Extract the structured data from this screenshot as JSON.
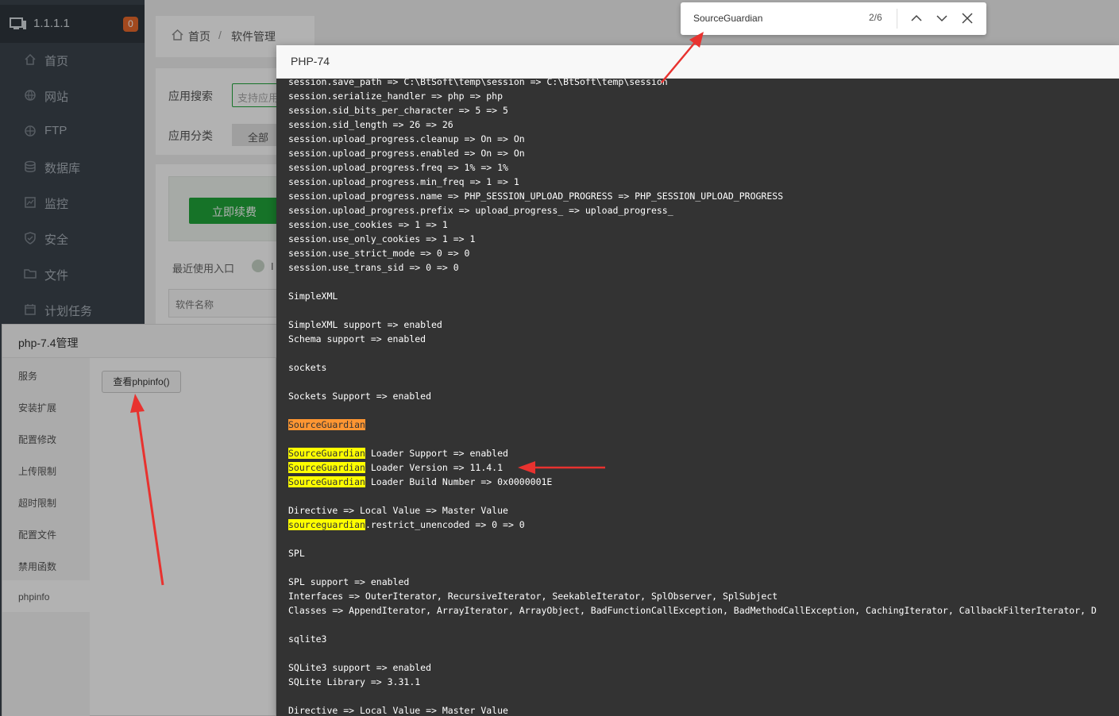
{
  "sidebar": {
    "ip": "1.1.1.1",
    "badge": "0",
    "items": [
      {
        "label": "首页"
      },
      {
        "label": "网站"
      },
      {
        "label": "FTP"
      },
      {
        "label": "数据库"
      },
      {
        "label": "监控"
      },
      {
        "label": "安全"
      },
      {
        "label": "文件"
      },
      {
        "label": "计划任务"
      }
    ]
  },
  "breadcrumb": {
    "home": "首页",
    "separator": "/",
    "current": "软件管理"
  },
  "main": {
    "search_label": "应用搜索",
    "search_placeholder": "支持应用",
    "category_label": "应用分类",
    "category_all": "全部",
    "renew_button": "立即续费",
    "recent_label": "最近使用入口",
    "recent_extra": "I",
    "table_header_name": "软件名称"
  },
  "php_manager": {
    "title": "php-7.4管理",
    "nav": [
      {
        "label": "服务"
      },
      {
        "label": "安装扩展"
      },
      {
        "label": "配置修改"
      },
      {
        "label": "上传限制"
      },
      {
        "label": "超时限制"
      },
      {
        "label": "配置文件"
      },
      {
        "label": "禁用函数"
      },
      {
        "label": "phpinfo"
      }
    ],
    "phpinfo_button": "查看phpinfo()"
  },
  "php_dialog": {
    "title": "PHP-74",
    "lines": [
      "session.save_path => C:\\BtSoft\\temp\\session => C:\\BtSoft\\temp\\session",
      "session.serialize_handler => php => php",
      "session.sid_bits_per_character => 5 => 5",
      "session.sid_length => 26 => 26",
      "session.upload_progress.cleanup => On => On",
      "session.upload_progress.enabled => On => On",
      "session.upload_progress.freq => 1% => 1%",
      "session.upload_progress.min_freq => 1 => 1",
      "session.upload_progress.name => PHP_SESSION_UPLOAD_PROGRESS => PHP_SESSION_UPLOAD_PROGRESS",
      "session.upload_progress.prefix => upload_progress_ => upload_progress_",
      "session.use_cookies => 1 => 1",
      "session.use_only_cookies => 1 => 1",
      "session.use_strict_mode => 0 => 0",
      "session.use_trans_sid => 0 => 0",
      "",
      "SimpleXML",
      "",
      "SimpleXML support => enabled",
      "Schema support => enabled",
      "",
      "sockets",
      "",
      "Sockets Support => enabled",
      "",
      {
        "hl_current": "SourceGuardian",
        "rest": ""
      },
      "",
      {
        "hl": "SourceGuardian",
        "rest": " Loader Support => enabled"
      },
      {
        "hl": "SourceGuardian",
        "rest": " Loader Version => 11.4.1"
      },
      {
        "hl": "SourceGuardian",
        "rest": " Loader Build Number => 0x0000001E"
      },
      "",
      "Directive => Local Value => Master Value",
      {
        "hl": "sourceguardian",
        "rest": ".restrict_unencoded => 0 => 0"
      },
      "",
      "SPL",
      "",
      "SPL support => enabled",
      "Interfaces => OuterIterator, RecursiveIterator, SeekableIterator, SplObserver, SplSubject",
      "Classes => AppendIterator, ArrayIterator, ArrayObject, BadFunctionCallException, BadMethodCallException, CachingIterator, CallbackFilterIterator, D",
      "",
      "sqlite3",
      "",
      "SQLite3 support => enabled",
      "SQLite Library => 3.31.1",
      "",
      "Directive => Local Value => Master Value"
    ]
  },
  "find_bar": {
    "query": "SourceGuardian",
    "count": "2/6"
  },
  "colors": {
    "accent_green": "#20a53a",
    "badge_orange": "#e8692b",
    "highlight": "#ffff00",
    "highlight_current": "#ff9632",
    "annotation_arrow": "#e8322f"
  }
}
